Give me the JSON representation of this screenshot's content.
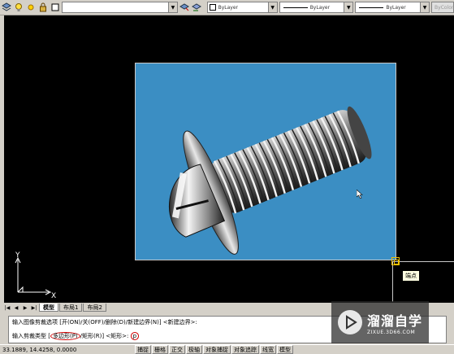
{
  "toolbar": {
    "layer_combo_value": "",
    "bylayer_color": "ByLayer",
    "bylayer_linetype": "ByLayer",
    "bylayer_lineweight": "ByLayer",
    "plot_style": "ByColor"
  },
  "canvas": {
    "tooltip": "端点",
    "ucs_x_label": "X",
    "ucs_y_label": "Y",
    "image_background": "#3b8ec3"
  },
  "tabs": {
    "items": [
      "模型",
      "布局1",
      "布局2"
    ],
    "active_index": 0
  },
  "command": {
    "line1": "输入图像剪裁选项 [开(ON)/关(OFF)/删除(D)/新建边界(N)] <新建边界>:",
    "line2_prefix": "输入剪裁类型 [",
    "line2_polygon": "多边形(P)",
    "line2_middle": "/矩形(R)] <矩形>:",
    "line2_input": "p"
  },
  "status": {
    "coords": "33.1889, 14.4258, 0.0000",
    "buttons": [
      "捕捉",
      "栅格",
      "正交",
      "极轴",
      "对象捕捉",
      "对象追踪",
      "线宽",
      "模型"
    ]
  },
  "watermark": {
    "title": "溜溜自学",
    "url": "ZIXUE.3D66.COM"
  },
  "colors": {
    "canvas": "#000000",
    "annotation_red": "#d00000",
    "grip": "#f0c000"
  }
}
